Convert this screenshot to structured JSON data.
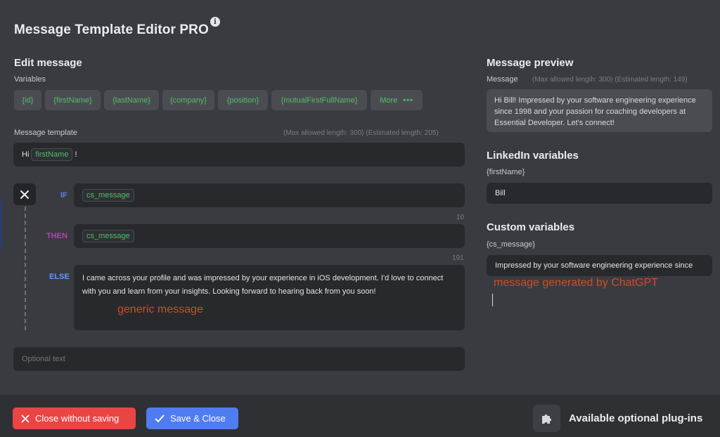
{
  "header": {
    "title": "Message Template Editor PRO"
  },
  "edit": {
    "heading": "Edit message",
    "variables_label": "Variables",
    "variables": [
      "{id}",
      "{firstName}",
      "{lastName}",
      "{company}",
      "{position}",
      "{mutualFirstFullName}"
    ],
    "more_label": "More",
    "template_label": "Message template",
    "template_hint": "(Max allowed length: 300) (Estimated length: 205)",
    "template_prefix": "Hi",
    "template_tag": "firstName",
    "template_suffix": "!"
  },
  "condition": {
    "if_label": "IF",
    "if_tag": "cs_message",
    "then_label": "THEN",
    "then_tag": "cs_message",
    "then_count": "10",
    "else_label": "ELSE",
    "else_count": "191",
    "else_text": "I came across your profile and was impressed by your experience in iOS development. I'd love to connect with you and learn from your insights. Looking forward to hearing back from you soon!",
    "optional_placeholder": "Optional text"
  },
  "preview": {
    "heading": "Message preview",
    "message_label": "Message",
    "message_hint": "(Max allowed length: 300) (Estimated length: 149)",
    "message_text": "Hi Bill! Impressed by your software engineering experience since 1998 and your passion for coaching developers at Essential Developer. Let's connect!"
  },
  "linkedin": {
    "heading": "LinkedIn variables",
    "var_label": "{firstName}",
    "var_value": "Bill"
  },
  "custom": {
    "heading": "Custom variables",
    "var_label": "{cs_message}",
    "var_value": "Impressed by your software engineering experience since"
  },
  "annotations": {
    "generic": "generic message",
    "chatgpt": "message generated by ChatGPT"
  },
  "footer": {
    "close_label": "Close without saving",
    "save_label": "Save & Close",
    "plugins_label": "Available optional plug-ins"
  },
  "colors": {
    "background": "#3a3b40",
    "variable_green": "#4fbf6a",
    "if_color": "#5b7ef0",
    "then_color": "#c23bb0",
    "else_color": "#5aa0f0",
    "close_red": "#ea4545",
    "save_blue": "#4f7cf1",
    "annotation": "#cf4d27"
  },
  "icons": {
    "info": "info-icon",
    "close": "close-icon",
    "check": "check-icon",
    "puzzle": "puzzle-icon"
  }
}
